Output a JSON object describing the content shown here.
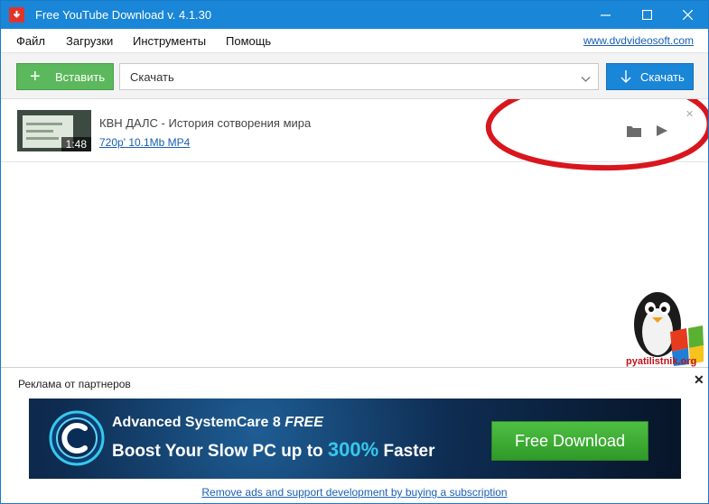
{
  "window": {
    "title": "Free YouTube Download v. 4.1.30"
  },
  "menu": {
    "items": [
      "Файл",
      "Загрузки",
      "Инструменты",
      "Помощь"
    ],
    "site_link": "www.dvdvideosoft.com"
  },
  "toolbar": {
    "paste_label": "Вставить",
    "url_value": "Скачать",
    "download_label": "Скачать"
  },
  "downloads": [
    {
      "title": "КВН ДАЛС - История сотворения мира",
      "duration": "1:48",
      "meta": "720p' 10.1Mb MP4"
    }
  ],
  "watermark": {
    "text": "pyatilistnik.org"
  },
  "ad": {
    "header": "Реклама от партнеров",
    "banner": {
      "line1_main": "Advanced SystemCare 8",
      "line1_emph": "FREE",
      "line2_pre": "Boost Your Slow PC up to",
      "line2_highlight": "300%",
      "line2_post": "Faster",
      "cta": "Free Download"
    },
    "footer_link": "Remove ads and support development by buying a subscription"
  },
  "colors": {
    "accent": "#1a86d8",
    "paste_green": "#5cb85c",
    "annotation_red": "#d9161d"
  }
}
